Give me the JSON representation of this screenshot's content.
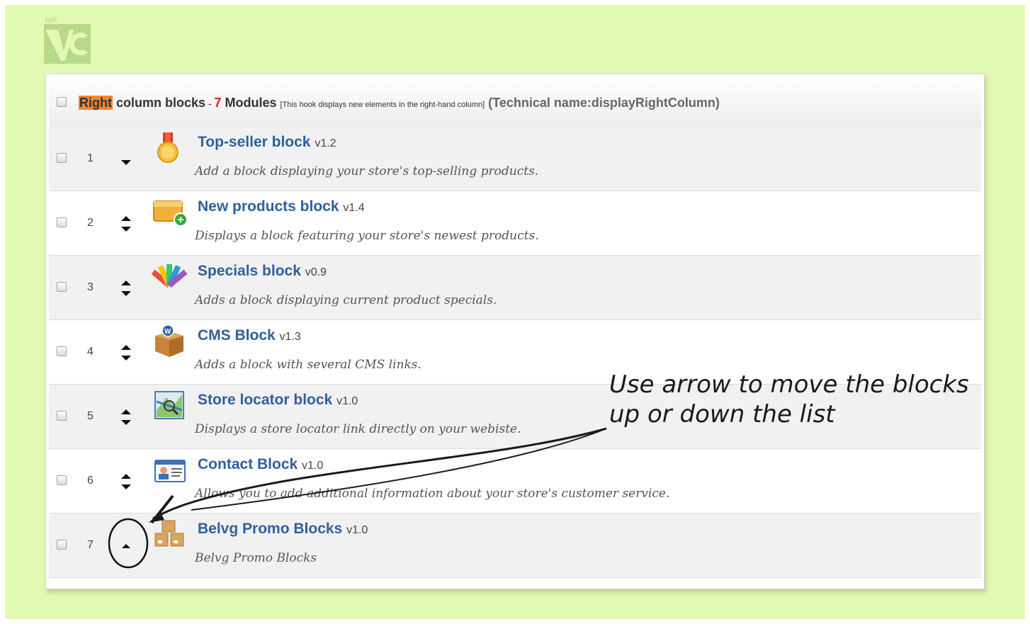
{
  "logo": {
    "text": "bel",
    "icon": "belvg-logo-icon"
  },
  "header": {
    "highlight": "Right",
    "rest": "column blocks",
    "dash": " - ",
    "count": "7",
    "modules": "Modules",
    "description": "[This hook displays new elements in the right-hand column]",
    "technical": "(Technical name:displayRightColumn)"
  },
  "modules": [
    {
      "position": "1",
      "name": "Top-seller block",
      "version": "v1.2",
      "description": "Add a block displaying your store's top-selling products.",
      "icon": "medal-icon",
      "arrows": "down"
    },
    {
      "position": "2",
      "name": "New products block",
      "version": "v1.4",
      "description": "Displays a block featuring your store's newest products.",
      "icon": "new-products-icon",
      "arrows": "both"
    },
    {
      "position": "3",
      "name": "Specials block",
      "version": "v0.9",
      "description": "Adds a block displaying current product specials.",
      "icon": "color-swatches-icon",
      "arrows": "both"
    },
    {
      "position": "4",
      "name": "CMS Block",
      "version": "v1.3",
      "description": "Adds a block with several CMS links.",
      "icon": "cms-box-icon",
      "arrows": "both"
    },
    {
      "position": "5",
      "name": "Store locator block",
      "version": "v1.0",
      "description": "Displays a store locator link directly on your webiste.",
      "icon": "map-icon",
      "arrows": "both"
    },
    {
      "position": "6",
      "name": "Contact Block",
      "version": "v1.0",
      "description": "Allows you to add additional information about your store's customer service.",
      "icon": "contact-card-icon",
      "arrows": "both"
    },
    {
      "position": "7",
      "name": "Belvg Promo Blocks",
      "version": "v1.0",
      "description": "Belvg Promo Blocks",
      "icon": "boxes-icon",
      "arrows": "up"
    }
  ],
  "annotation": {
    "line1": "Use arrow to move the blocks",
    "line2": "up or down the list"
  },
  "colors": {
    "background": "#e2f9b3",
    "title": "#2f5f9e",
    "highlight": "#f0862d",
    "count": "#e02020"
  }
}
